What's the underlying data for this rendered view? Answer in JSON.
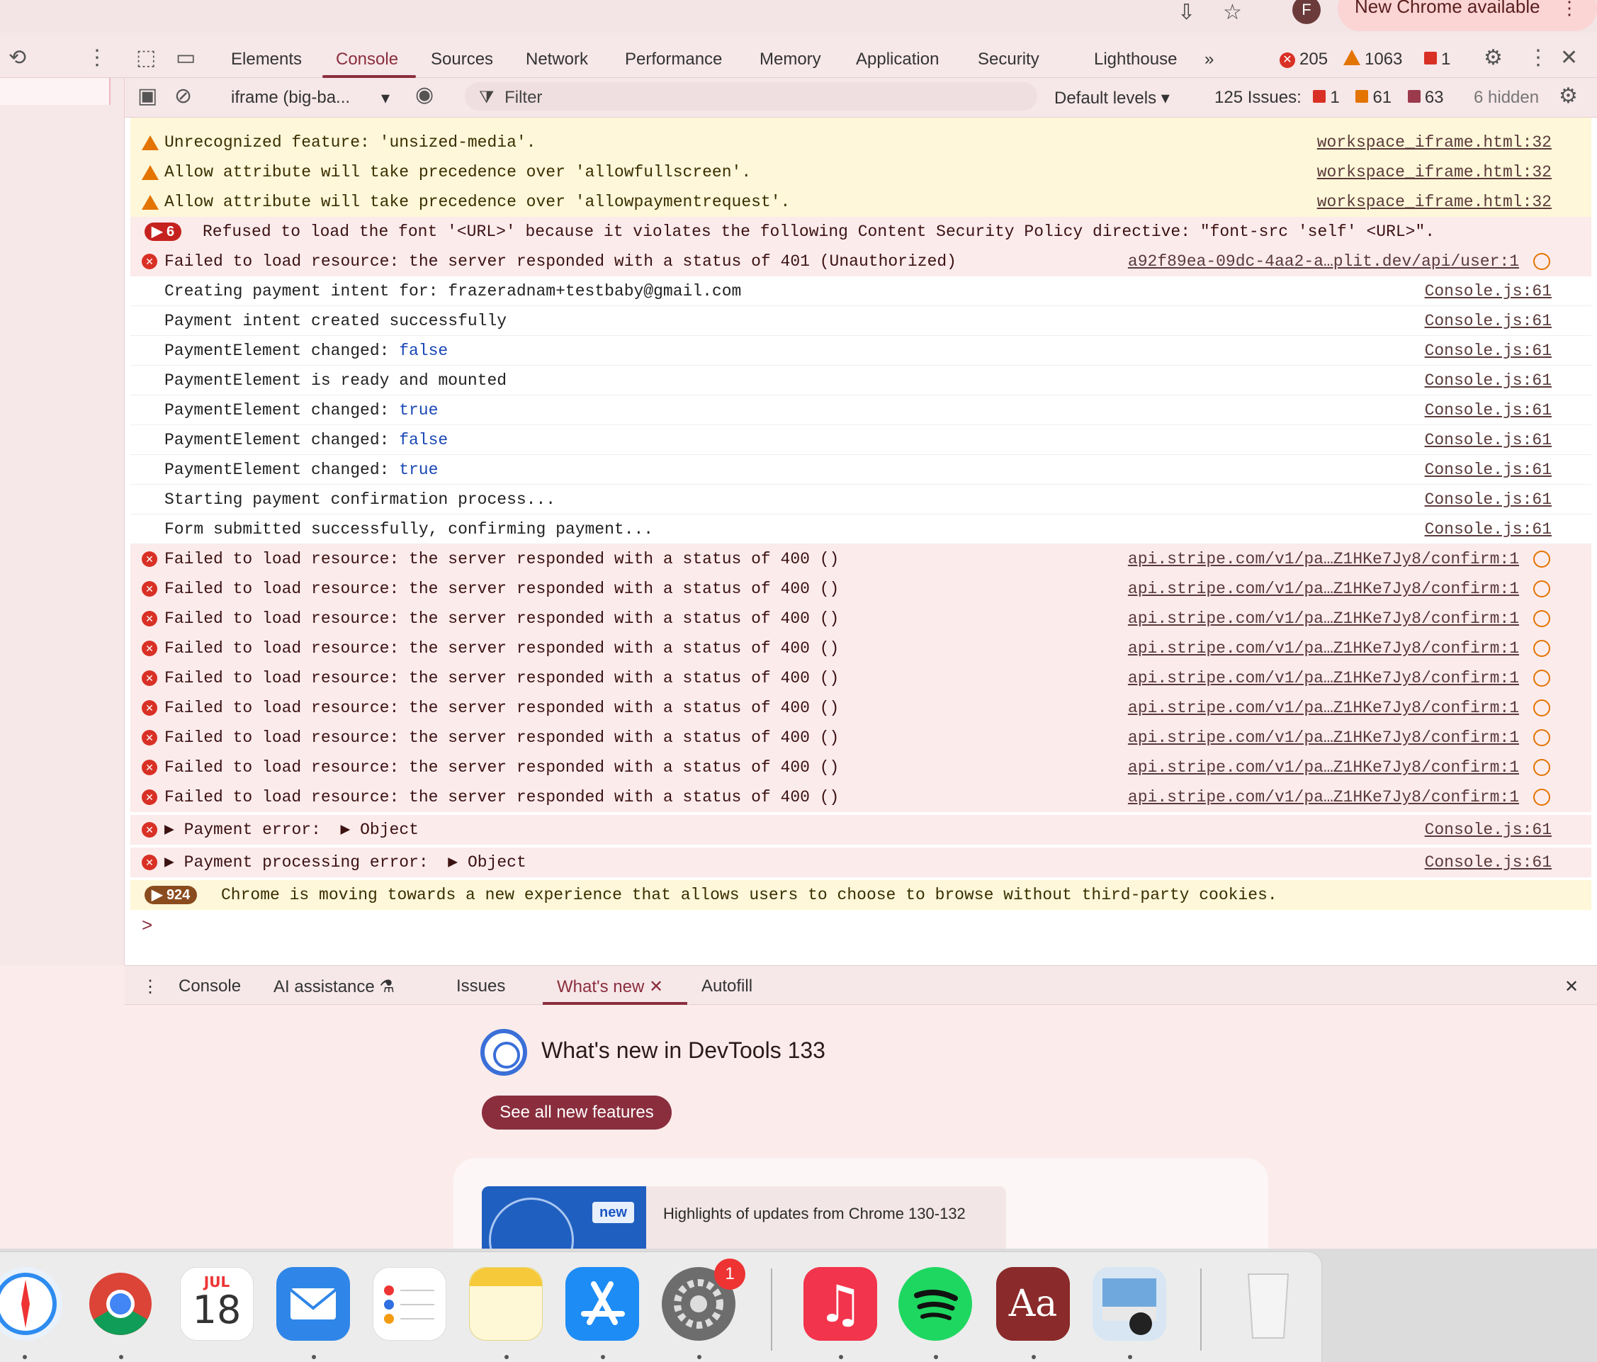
{
  "chrome": {
    "update_label": "New Chrome available",
    "avatar_letter": "F",
    "menu_glyph": "⋮",
    "star_glyph": "☆",
    "install_glyph": "⇩"
  },
  "devtools": {
    "tabs": [
      "Elements",
      "Console",
      "Sources",
      "Network",
      "Performance",
      "Memory",
      "Application",
      "Security",
      "Lighthouse"
    ],
    "active_tab": "Console",
    "more_tabs_glyph": "»",
    "counts": {
      "errors": "205",
      "warnings": "1063",
      "issues": "1"
    },
    "close_glyph": "✕",
    "settings_glyph": "⚙",
    "kebab_glyph": "⋮"
  },
  "console_toolbar": {
    "context": "iframe (big-ba...",
    "filter_placeholder": "Filter",
    "levels": "Default levels",
    "issues_label": "125 Issues:",
    "issue_errors": "1",
    "issue_warnings": "61",
    "issue_info": "63",
    "hidden": "6 hidden",
    "dropdown_glyph": "▾",
    "eye_glyph": "◉",
    "clear_glyph": "⊘",
    "sidebar_glyph": "▣",
    "filter_glyph": "⧩"
  },
  "console_rows": [
    {
      "level": "warn",
      "text": "Unrecognized feature: 'unsized-media'.",
      "source": "workspace_iframe.html:32"
    },
    {
      "level": "warn",
      "text": "Allow attribute will take precedence over 'allowfullscreen'.",
      "source": "workspace_iframe.html:32"
    },
    {
      "level": "warn",
      "text": "Allow attribute will take precedence over 'allowpaymentrequest'.",
      "source": "workspace_iframe.html:32"
    },
    {
      "level": "error-group",
      "badge": "6",
      "text": "Refused to load the font '<URL>' because it violates the following Content Security Policy directive: \"font-src 'self' <URL>\".",
      "source": ""
    },
    {
      "level": "error",
      "text": "Failed to load resource: the server responded with a status of 401 (Unauthorized)",
      "source": "a92f89ea-09dc-4aa2-a…plit.dev/api/user:1"
    },
    {
      "level": "log",
      "text": "Creating payment intent for: frazeradnam+testbaby@gmail.com",
      "source": "Console.js:61"
    },
    {
      "level": "log",
      "text": "Payment intent created successfully",
      "source": "Console.js:61"
    },
    {
      "level": "log",
      "text": "PaymentElement changed: ",
      "value": "false",
      "source": "Console.js:61"
    },
    {
      "level": "log",
      "text": "PaymentElement is ready and mounted",
      "source": "Console.js:61"
    },
    {
      "level": "log",
      "text": "PaymentElement changed: ",
      "value": "true",
      "source": "Console.js:61"
    },
    {
      "level": "log",
      "text": "PaymentElement changed: ",
      "value": "false",
      "source": "Console.js:61"
    },
    {
      "level": "log",
      "text": "PaymentElement changed: ",
      "value": "true",
      "source": "Console.js:61"
    },
    {
      "level": "log",
      "text": "Starting payment confirmation process...",
      "source": "Console.js:61"
    },
    {
      "level": "log",
      "text": "Form submitted successfully, confirming payment...",
      "source": "Console.js:61"
    },
    {
      "level": "error",
      "text": "Failed to load resource: the server responded with a status of 400 ()",
      "source": "api.stripe.com/v1/pa…Z1HKe7Jy8/confirm:1"
    },
    {
      "level": "error",
      "text": "Failed to load resource: the server responded with a status of 400 ()",
      "source": "api.stripe.com/v1/pa…Z1HKe7Jy8/confirm:1"
    },
    {
      "level": "error",
      "text": "Failed to load resource: the server responded with a status of 400 ()",
      "source": "api.stripe.com/v1/pa…Z1HKe7Jy8/confirm:1"
    },
    {
      "level": "error",
      "text": "Failed to load resource: the server responded with a status of 400 ()",
      "source": "api.stripe.com/v1/pa…Z1HKe7Jy8/confirm:1"
    },
    {
      "level": "error",
      "text": "Failed to load resource: the server responded with a status of 400 ()",
      "source": "api.stripe.com/v1/pa…Z1HKe7Jy8/confirm:1"
    },
    {
      "level": "error",
      "text": "Failed to load resource: the server responded with a status of 400 ()",
      "source": "api.stripe.com/v1/pa…Z1HKe7Jy8/confirm:1"
    },
    {
      "level": "error",
      "text": "Failed to load resource: the server responded with a status of 400 ()",
      "source": "api.stripe.com/v1/pa…Z1HKe7Jy8/confirm:1"
    },
    {
      "level": "error",
      "text": "Failed to load resource: the server responded with a status of 400 ()",
      "source": "api.stripe.com/v1/pa…Z1HKe7Jy8/confirm:1"
    },
    {
      "level": "error",
      "text": "Failed to load resource: the server responded with a status of 400 ()",
      "source": "api.stripe.com/v1/pa…Z1HKe7Jy8/confirm:1"
    },
    {
      "level": "error",
      "text": "▶ Payment error:  ▶ Object",
      "source": "Console.js:61"
    },
    {
      "level": "error",
      "text": "▶ Payment processing error:  ▶ Object",
      "source": "Console.js:61"
    },
    {
      "level": "warn-group",
      "badge": "924",
      "text": "Chrome is moving towards a new experience that allows users to choose to browse without third-party cookies.",
      "source": ""
    }
  ],
  "prompt_glyph": ">",
  "drawer": {
    "tabs": [
      "Console",
      "AI assistance",
      "Issues",
      "What's new",
      "Autofill"
    ],
    "active_tab": "What's new",
    "close_glyph": "✕",
    "title": "What's new in DevTools 133",
    "button": "See all new features",
    "card_badge": "new",
    "card_text": "Highlights of updates from Chrome 130-132"
  },
  "dock": {
    "apps": [
      "safari",
      "chrome",
      "calendar",
      "mail",
      "reminders",
      "notes",
      "app-store",
      "system-settings",
      "music",
      "spotify",
      "dictionary",
      "preview",
      "trash"
    ],
    "calendar_month": "JUL",
    "calendar_day": "18",
    "settings_badge": "1",
    "dictionary_text": "Aa"
  },
  "colors": {
    "accent": "#8a2e3d",
    "error": "#d93025",
    "warning": "#e37400",
    "keyword": "#1a47b5"
  }
}
